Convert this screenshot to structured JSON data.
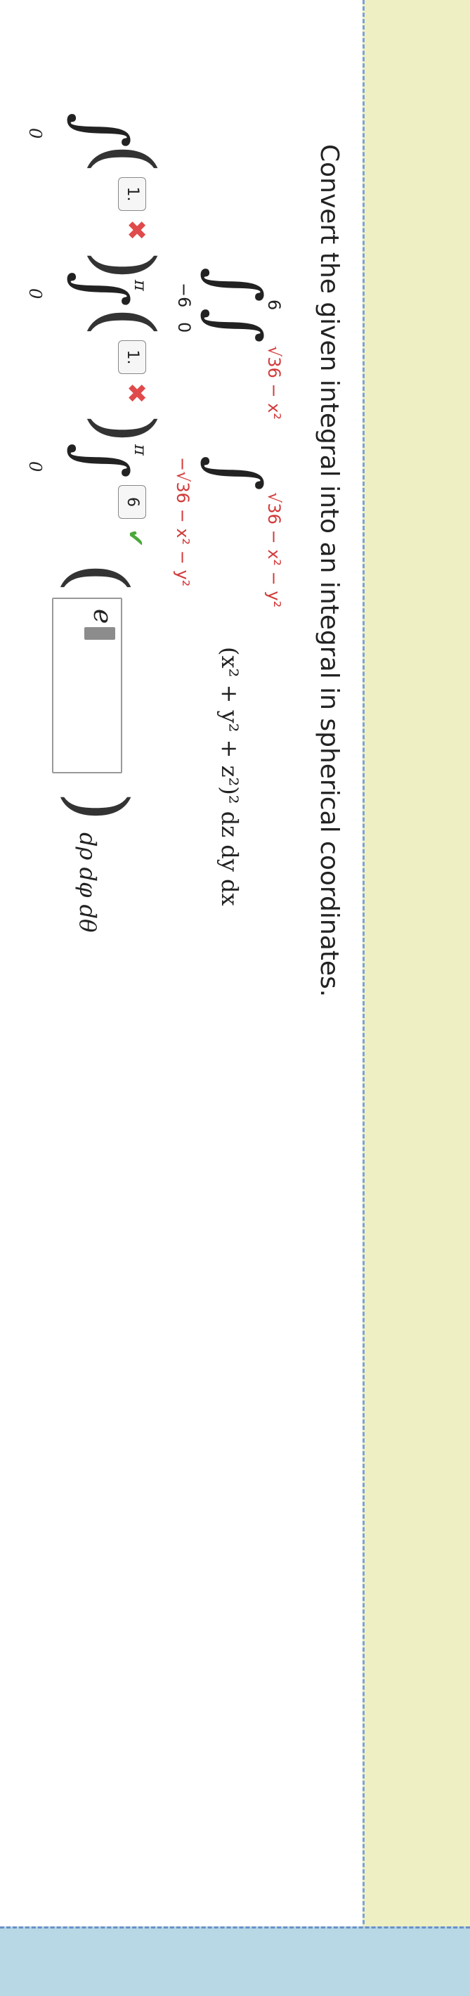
{
  "question": {
    "title": "Convert the given integral into an integral in spherical coordinates."
  },
  "cartesian": {
    "outer_upper": "6",
    "outer_lower": "−6",
    "middle_upper": "√36 − x²",
    "middle_lower": "0",
    "inner_upper": "√36 − x² − y²",
    "inner_lower": "−√36 − x² − y²",
    "integrand": "(x² + y² + z²)² dz dy dx"
  },
  "spherical": {
    "outer_lower": "0",
    "outer_upper_answer": "1.",
    "outer_upper_status": "incorrect",
    "middle_lower": "0",
    "middle_upper_prefix": "π",
    "middle_upper_answer": "1.",
    "middle_upper_status": "incorrect",
    "inner_lower": "0",
    "inner_upper_prefix": "π",
    "inner_upper_answer": "6",
    "inner_upper_status": "correct",
    "integrand_value": "e",
    "differentials": "dρ dφ dθ"
  },
  "icons": {
    "incorrect": "x-mark-icon",
    "correct": "check-mark-icon"
  },
  "colors": {
    "incorrect": "#e04a4a",
    "correct": "#4aa83a",
    "limit_red": "#d23a3a"
  }
}
